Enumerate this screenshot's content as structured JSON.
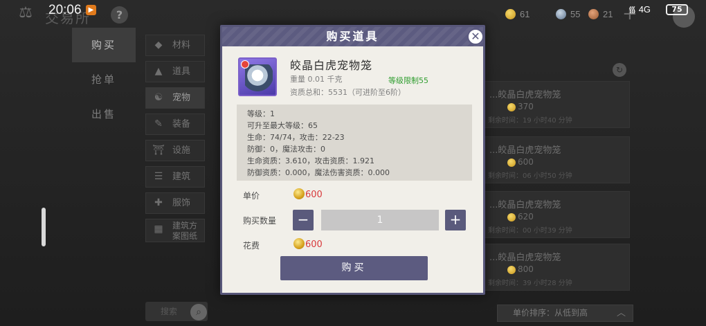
{
  "status_bar": {
    "time": "20:06",
    "battery": "75",
    "network": "4G"
  },
  "background": {
    "title": "交易所",
    "currencies": {
      "gold": "61",
      "gem": "55",
      "bronze": "21"
    },
    "left_tabs": [
      {
        "label": "购买",
        "active": true
      },
      {
        "label": "抢单",
        "active": false
      },
      {
        "label": "出售",
        "active": false
      }
    ],
    "categories": [
      {
        "label": "材料",
        "icon": "material-icon"
      },
      {
        "label": "道具",
        "icon": "potion-icon"
      },
      {
        "label": "宠物",
        "icon": "pet-icon",
        "active": true
      },
      {
        "label": "装备",
        "icon": "equipment-icon"
      },
      {
        "label": "设施",
        "icon": "facility-icon"
      },
      {
        "label": "建筑",
        "icon": "building-icon"
      },
      {
        "label": "服饰",
        "icon": "clothing-icon"
      },
      {
        "label": "建筑方案图纸",
        "icon": "blueprint-icon"
      }
    ],
    "search_placeholder": "搜索",
    "listings": [
      {
        "name": "...皎晶白虎宠物笼",
        "price": "370",
        "time": "剩余时间：19 小时40 分钟"
      },
      {
        "name": "...皎晶白虎宠物笼",
        "price": "600",
        "time": "剩余时间：06 小时50 分钟"
      },
      {
        "name": "...皎晶白虎宠物笼",
        "price": "620",
        "time": "剩余时间：00 小时39 分钟"
      },
      {
        "name": "...皎晶白虎宠物笼",
        "price": "800",
        "time": "剩余时间：39 小时28 分钟"
      }
    ],
    "sort_label": "单价排序：从低到高"
  },
  "modal": {
    "title": "购买道具",
    "item": {
      "name": "皎晶白虎宠物笼",
      "weight": "重量  0.01 千克",
      "level_req": "等级限制55",
      "quality_total": "资质总和：5531（可进阶至6阶）"
    },
    "stats": [
      "等级：1",
      "可升至最大等级：65",
      "生命：74/74，攻击：22-23",
      "防御：0，魔法攻击：0",
      "生命资质：3.610，攻击资质：1.921",
      "防御资质：0.000，魔法伤害资质：0.000"
    ],
    "unit_price_label": "单价",
    "unit_price": "600",
    "qty_label": "购买数量",
    "qty_value": "1",
    "cost_label": "花费",
    "cost": "600",
    "buy_label": "购买"
  },
  "colors": {
    "accent": "#5c5b80",
    "price": "#d8393b",
    "level_green": "#2f9d2f"
  }
}
